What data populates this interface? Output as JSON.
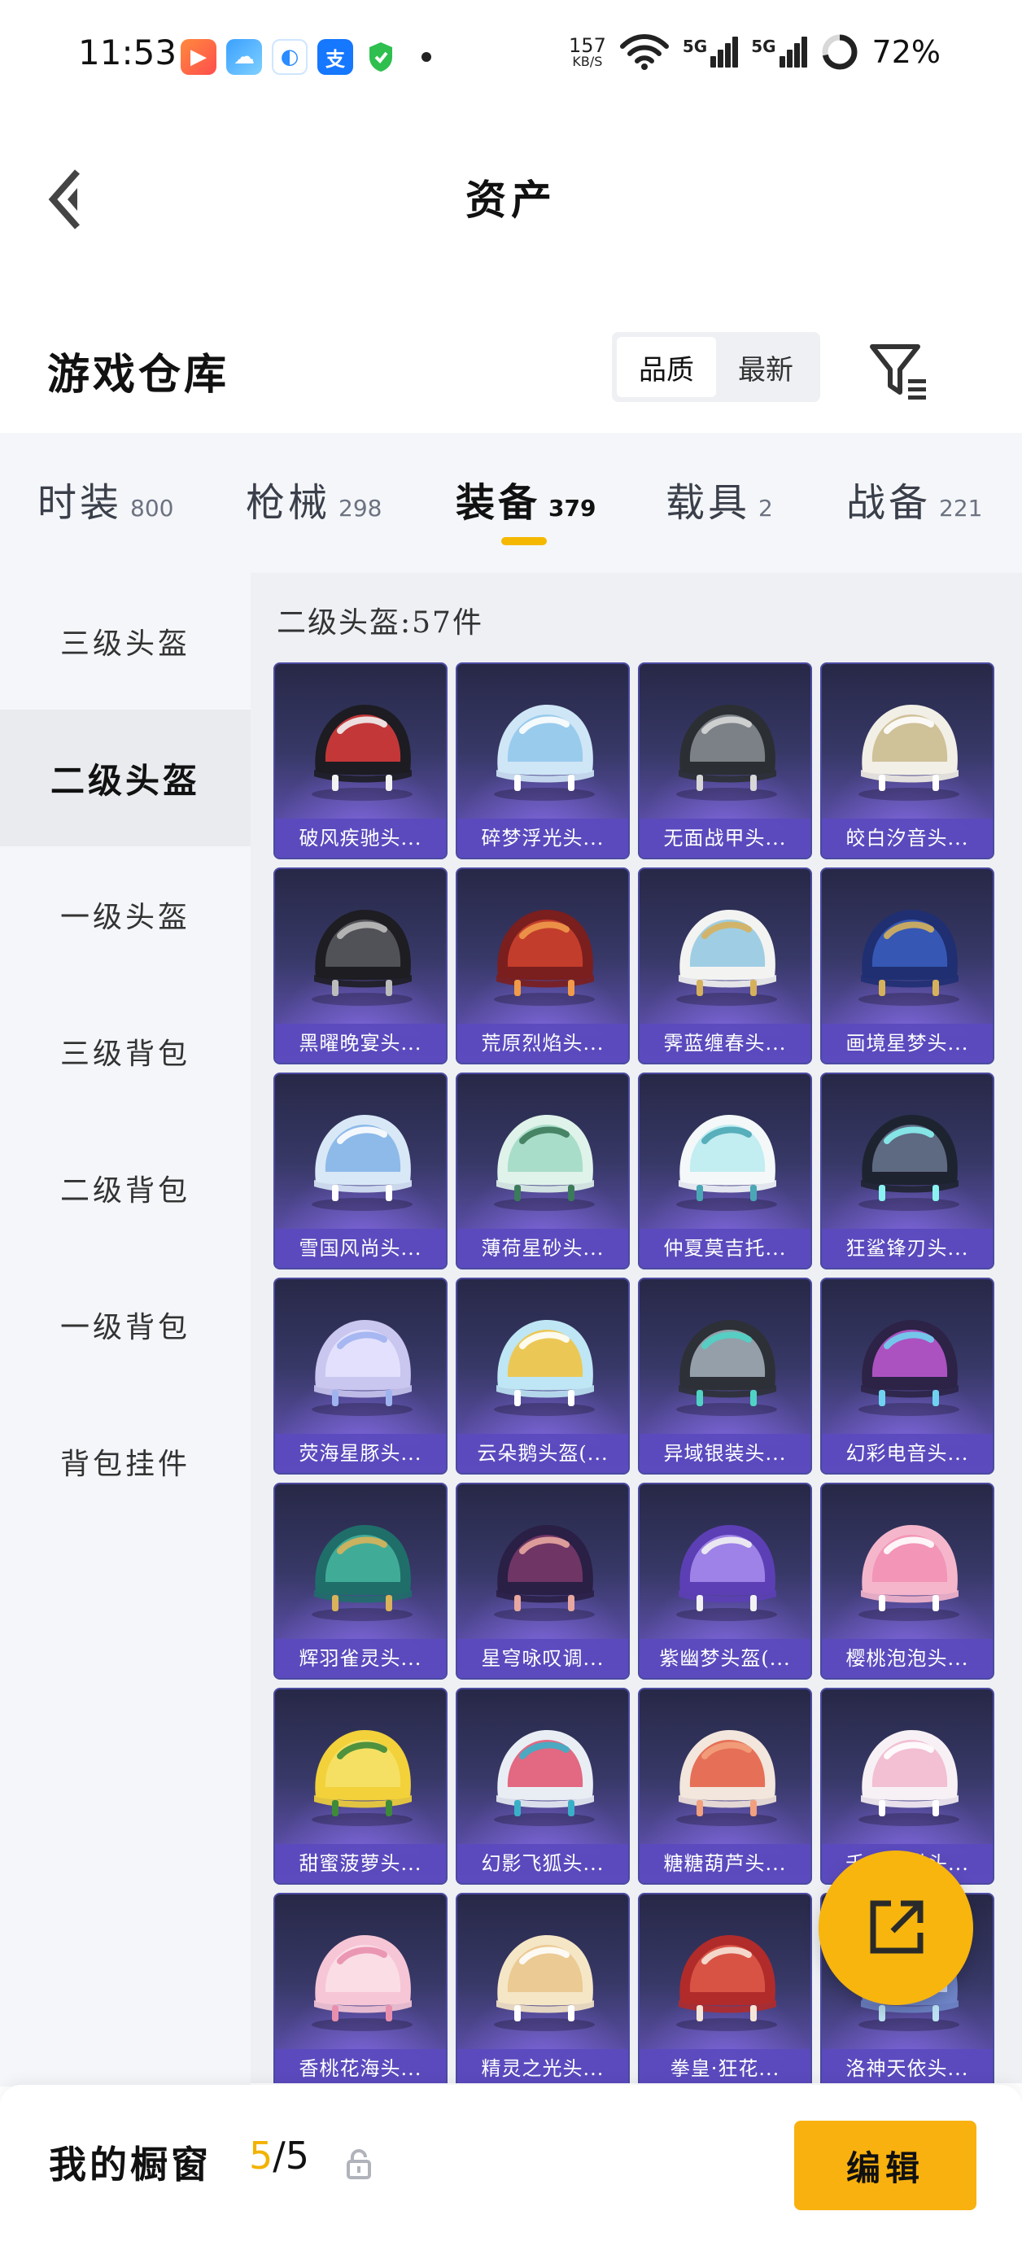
{
  "status_bar": {
    "time": "11:53",
    "net_speed_value": "157",
    "net_speed_unit": "KB/S",
    "signal_label_1": "5G",
    "signal_label_2": "5G",
    "battery": "72%"
  },
  "header": {
    "title": "资产"
  },
  "warehouse": {
    "title": "游戏仓库",
    "sort_options": [
      "品质",
      "最新"
    ],
    "selected_sort": "品质"
  },
  "category_tabs": [
    {
      "label": "时装",
      "count": "800"
    },
    {
      "label": "枪械",
      "count": "298"
    },
    {
      "label": "装备",
      "count": "379"
    },
    {
      "label": "载具",
      "count": "2"
    },
    {
      "label": "战备",
      "count": "221"
    }
  ],
  "selected_category": "装备",
  "sidebar": {
    "items": [
      "三级头盔",
      "二级头盔",
      "一级头盔",
      "三级背包",
      "二级背包",
      "一级背包",
      "背包挂件"
    ],
    "selected": "二级头盔"
  },
  "content": {
    "heading": "二级头盔:57件",
    "items": [
      {
        "name": "破风疾驰头...",
        "colors": [
          "#1c1c22",
          "#e23c3c",
          "#f2f2f2"
        ]
      },
      {
        "name": "碎梦浮光头...",
        "colors": [
          "#cfe6f6",
          "#8fc6ea",
          "#ffffff"
        ]
      },
      {
        "name": "无面战甲头...",
        "colors": [
          "#2b2f33",
          "#8a8f96",
          "#d7d7d7"
        ]
      },
      {
        "name": "皎白汐音头...",
        "colors": [
          "#f2efe6",
          "#c9b98a",
          "#ffffff"
        ]
      },
      {
        "name": "黑曜晚宴头...",
        "colors": [
          "#1d1d22",
          "#5a5a62",
          "#bcbcbc"
        ]
      },
      {
        "name": "荒原烈焰头...",
        "colors": [
          "#7b1e1e",
          "#d0432f",
          "#f09a4a"
        ]
      },
      {
        "name": "霁蓝缠春头...",
        "colors": [
          "#f3f4f2",
          "#8fc7e2",
          "#d6b15c"
        ]
      },
      {
        "name": "画境星梦头...",
        "colors": [
          "#1f2f72",
          "#3b5fbf",
          "#d6b15c"
        ]
      },
      {
        "name": "雪国风尚头...",
        "colors": [
          "#d9e8f7",
          "#7fb2e6",
          "#ffffff"
        ]
      },
      {
        "name": "薄荷星砂头...",
        "colors": [
          "#dff3ea",
          "#9fd8c3",
          "#3b7a5a"
        ]
      },
      {
        "name": "仲夏莫吉托...",
        "colors": [
          "#f4f8f9",
          "#b8ebf0",
          "#4aa7b5"
        ]
      },
      {
        "name": "狂鲨锋刃头...",
        "colors": [
          "#1e2330",
          "#6a7691",
          "#8af2f0"
        ]
      },
      {
        "name": "荧海星豚头...",
        "colors": [
          "#c9c6ef",
          "#e7e4ff",
          "#9fb3ef"
        ]
      },
      {
        "name": "云朵鹅头盔(...",
        "colors": [
          "#bfe6f4",
          "#f2c23a",
          "#ffffff"
        ]
      },
      {
        "name": "异域银装头...",
        "colors": [
          "#2d3036",
          "#a7b3bd",
          "#4fd3c5"
        ]
      },
      {
        "name": "幻彩电音头...",
        "colors": [
          "#2c2346",
          "#c25bd6",
          "#6fd2f0"
        ]
      },
      {
        "name": "辉羽雀灵头...",
        "colors": [
          "#1f6e6a",
          "#47b7a0",
          "#d9b25a"
        ]
      },
      {
        "name": "星穹咏叹调...",
        "colors": [
          "#2a1f45",
          "#7a3a6b",
          "#e8a7a0"
        ]
      },
      {
        "name": "紫幽梦头盔(...",
        "colors": [
          "#5c3fb5",
          "#a98ef0",
          "#f2f2f2"
        ]
      },
      {
        "name": "樱桃泡泡头...",
        "colors": [
          "#f5b6cc",
          "#f18fb1",
          "#ffffff"
        ]
      },
      {
        "name": "甜蜜菠萝头...",
        "colors": [
          "#f2d13a",
          "#f6e36b",
          "#3d8a3a"
        ]
      },
      {
        "name": "幻影飞狐头...",
        "colors": [
          "#e9eef5",
          "#e2506c",
          "#3ab0c8"
        ]
      },
      {
        "name": "糖糖葫芦头...",
        "colors": [
          "#f3e6dc",
          "#e25a3f",
          "#f2a07d"
        ]
      },
      {
        "name": "千金...猫头...",
        "colors": [
          "#f7f1f5",
          "#f1b6cc",
          "#ffffff"
        ]
      },
      {
        "name": "香桃花海头...",
        "colors": [
          "#f6c6d6",
          "#fbe0e8",
          "#e88fae"
        ]
      },
      {
        "name": "精灵之光头...",
        "colors": [
          "#f5e6c6",
          "#e9c48a",
          "#ffffff"
        ]
      },
      {
        "name": "拳皇·狂花...",
        "colors": [
          "#b12b2b",
          "#e05a4a",
          "#f5e6d8"
        ]
      },
      {
        "name": "洛神天依头...",
        "colors": [
          "#6f86c9",
          "#d9e4ff",
          "#bde3f2"
        ]
      }
    ]
  },
  "bottom_bar": {
    "label": "我的橱窗",
    "count_current": "5",
    "count_total": "/5",
    "edit_label": "编辑"
  },
  "icons": [
    "back-arrow-icon",
    "filter-icon",
    "lock-icon",
    "share-icon"
  ],
  "colors": {
    "accent": "#f9b10f",
    "card_bg_top": "#272847",
    "card_bg_bottom": "#6b58c5",
    "card_label": "#5a4abe"
  }
}
